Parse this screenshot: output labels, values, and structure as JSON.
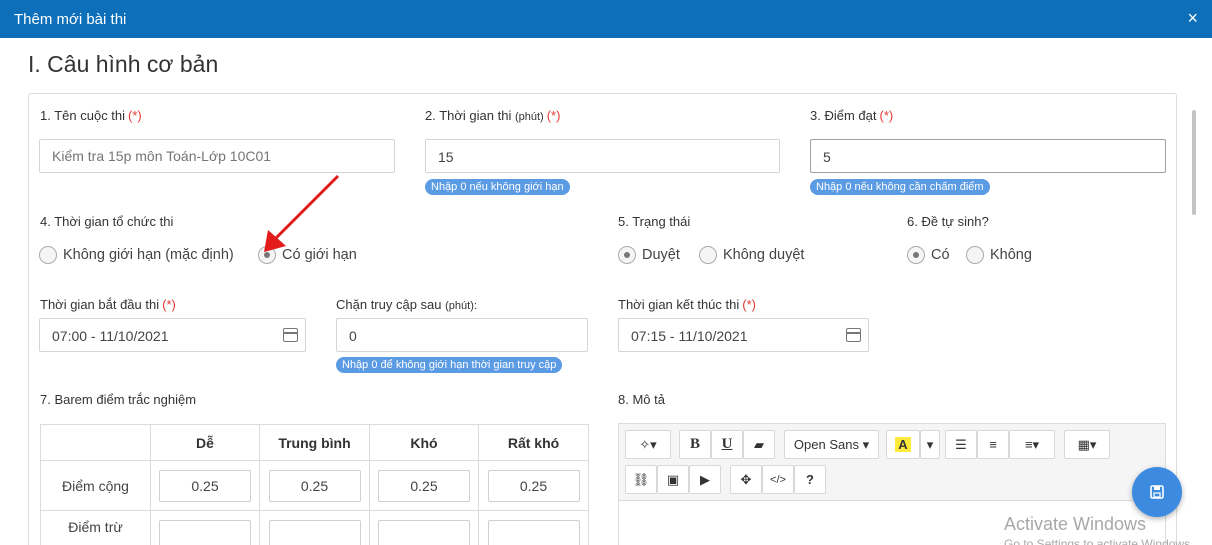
{
  "modal": {
    "title": "Thêm mới bài thi",
    "close": "×"
  },
  "section_title": "I. Câu hình cơ bản",
  "fields": {
    "contest_name": {
      "label": "1. Tên cuộc thi",
      "required": "(*)",
      "placeholder": "Kiểm tra 15p môn Toán-Lớp 10C01"
    },
    "duration": {
      "label": "2. Thời gian thi",
      "unit": "(phút)",
      "required": "(*)",
      "value": "15",
      "hint": "Nhập 0 nếu không giới hạn"
    },
    "pass_score": {
      "label": "3. Điểm đạt",
      "required": "(*)",
      "value": "5",
      "hint": "Nhập 0 nếu không cần chấm điểm"
    },
    "exam_time": {
      "label": "4. Thời gian tổ chức thi",
      "options": [
        "Không giới hạn (mặc định)",
        "Có giới hạn"
      ]
    },
    "status": {
      "label": "5. Trạng thái",
      "options": [
        "Duyệt",
        "Không duyệt"
      ]
    },
    "auto_gen": {
      "label": "6. Đề tự sinh?",
      "options": [
        "Có",
        "Không"
      ]
    },
    "start_time": {
      "label": "Thời gian bắt đầu thi",
      "required": "(*)",
      "value": "07:00 - 11/10/2021"
    },
    "block_access": {
      "label": "Chặn truy cập sau",
      "unit": "(phút):",
      "value": "0",
      "hint": "Nhập 0 để không giới hạn thời gian truy cập"
    },
    "end_time": {
      "label": "Thời gian kết thúc thi",
      "required": "(*)",
      "value": "07:15 - 11/10/2021"
    },
    "barem": {
      "label": "7. Barem điểm trắc nghiệm",
      "columns": [
        "Dễ",
        "Trung bình",
        "Khó",
        "Rất khó"
      ],
      "rows": [
        {
          "name": "Điểm cộng",
          "values": [
            "0.25",
            "0.25",
            "0.25",
            "0.25"
          ]
        },
        {
          "name": "Điểm trừ",
          "values": [
            "",
            "",
            "",
            ""
          ]
        }
      ]
    },
    "description": {
      "label": "8. Mô tả",
      "font": "Open Sans"
    }
  },
  "watermark": {
    "line1": "Activate Windows",
    "line2": "Go to Settings to activate Windows."
  }
}
